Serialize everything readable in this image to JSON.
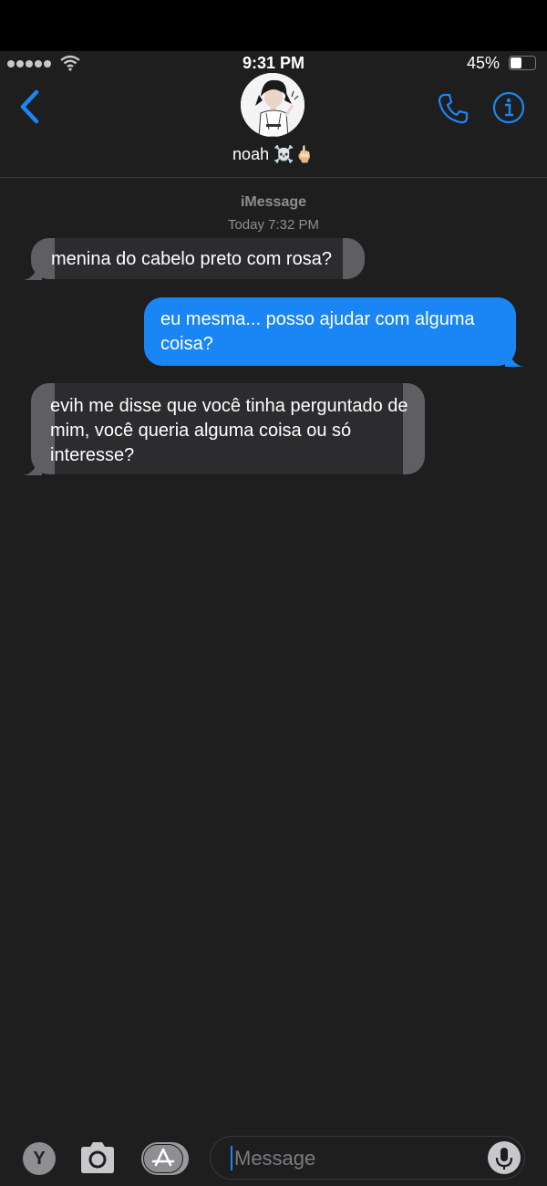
{
  "status_bar": {
    "time": "9:31 PM",
    "battery_percent": "45%",
    "battery_level": 0.45
  },
  "header": {
    "contact_name": "noah",
    "contact_emoji": "☠️🖕🏻",
    "icons": [
      "back-chevron-icon",
      "phone-icon",
      "info-icon"
    ],
    "accent_color": "#1a86f5"
  },
  "thread": {
    "service_label": "iMessage",
    "timestamp": "Today 7:32 PM",
    "messages": [
      {
        "direction": "incoming",
        "text": "menina do cabelo preto com rosa?"
      },
      {
        "direction": "outgoing",
        "text": "eu mesma... posso ajudar com alguma coisa?"
      },
      {
        "direction": "incoming",
        "text": "evih me disse que você tinha perguntado de mim, você queria alguma coisa ou só interesse?"
      }
    ]
  },
  "compose": {
    "placeholder": "Message",
    "app_button_letter": "Y",
    "icons": [
      "camera-icon",
      "app-store-icon",
      "microphone-icon"
    ]
  },
  "colors": {
    "background": "#1e1e1e",
    "incoming_bubble": "#2c2c2e",
    "outgoing_bubble": "#1a86f5",
    "secondary_text": "#8e8e93"
  }
}
